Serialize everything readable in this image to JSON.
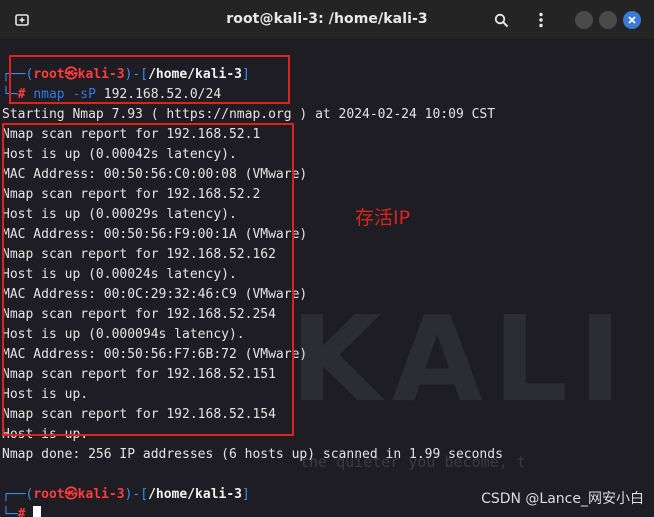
{
  "window": {
    "title": "root@kali-3: /home/kali-3",
    "icons": [
      "new-tab-icon",
      "search-icon",
      "kebab-menu-icon",
      "minimize-icon",
      "maximize-icon",
      "close-icon"
    ],
    "colors": {
      "titlebar": "#242424",
      "background": "#1d1d23",
      "close_button": "#3a7bd5"
    }
  },
  "background": {
    "logo_text": "KALI",
    "tagline": "the quieter you become, t"
  },
  "prompt": {
    "box_top": "┌──(",
    "user": "root㉿kali-3",
    "mid": ")-[",
    "path": "/home/kali-3",
    "close": "]",
    "box_bottom": "└─",
    "hash": "#",
    "colors": {
      "user": "#ff3b3b",
      "bracket": "#3b8eea",
      "command": "#2f7de1"
    }
  },
  "command": {
    "name": "nmap",
    "option": "-sP",
    "argument": "192.168.52.0/24"
  },
  "output": [
    "Starting Nmap 7.93 ( https://nmap.org ) at 2024-02-24 10:09 CST",
    "Nmap scan report for 192.168.52.1",
    "Host is up (0.00042s latency).",
    "MAC Address: 00:50:56:C0:00:08 (VMware)",
    "Nmap scan report for 192.168.52.2",
    "Host is up (0.00029s latency).",
    "MAC Address: 00:50:56:F9:00:1A (VMware)",
    "Nmap scan report for 192.168.52.162",
    "Host is up (0.00024s latency).",
    "MAC Address: 00:0C:29:32:46:C9 (VMware)",
    "Nmap scan report for 192.168.52.254",
    "Host is up (0.000094s latency).",
    "MAC Address: 00:50:56:F7:6B:72 (VMware)",
    "Nmap scan report for 192.168.52.151",
    "Host is up.",
    "Nmap scan report for 192.168.52.154",
    "Host is up.",
    "Nmap done: 256 IP addresses (6 hosts up) scanned in 1.99 seconds"
  ],
  "annotation": {
    "label": "存活IP",
    "color": "#e0221c"
  },
  "watermark": "CSDN @Lance_网安小白"
}
